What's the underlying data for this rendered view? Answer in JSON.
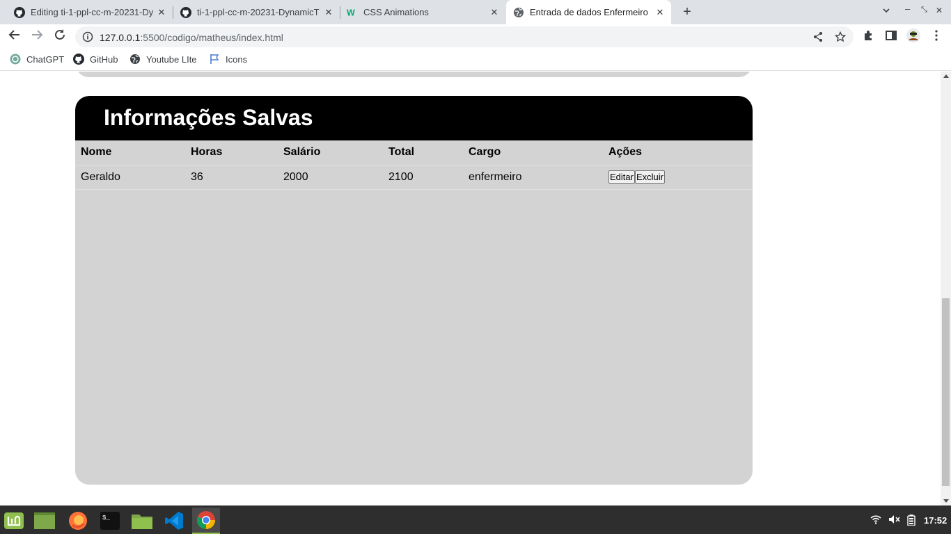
{
  "browser": {
    "tabs": [
      {
        "title": "Editing ti-1-ppl-cc-m-20231-Dy",
        "icon": "github-icon"
      },
      {
        "title": "ti-1-ppl-cc-m-20231-DynamicT",
        "icon": "github-icon"
      },
      {
        "title": "CSS Animations",
        "icon": "w3schools-icon"
      },
      {
        "title": "Entrada de dados Enfermeiro",
        "icon": "globe-icon"
      }
    ],
    "url_host": "127.0.0.1",
    "url_path": ":5500/codigo/matheus/index.html",
    "bookmarks": [
      {
        "label": "ChatGPT",
        "icon": "chatgpt-icon"
      },
      {
        "label": "GitHub",
        "icon": "github-icon"
      },
      {
        "label": "Youtube LIte",
        "icon": "globe-icon"
      },
      {
        "label": "Icons",
        "icon": "flag-icon"
      }
    ]
  },
  "page": {
    "section_title": "Informações Salvas",
    "table": {
      "headers": [
        "Nome",
        "Horas",
        "Salário",
        "Total",
        "Cargo",
        "Ações"
      ],
      "rows": [
        {
          "nome": "Geraldo",
          "horas": "36",
          "salario": "2000",
          "total": "2100",
          "cargo": "enfermeiro"
        }
      ],
      "edit_label": "Editar",
      "delete_label": "Excluir"
    }
  },
  "taskbar": {
    "clock": "17:52"
  },
  "colors": {
    "card_bg": "#d3d3d3",
    "header_bg": "#000000",
    "taskbar_bg": "#2e2e2e"
  }
}
